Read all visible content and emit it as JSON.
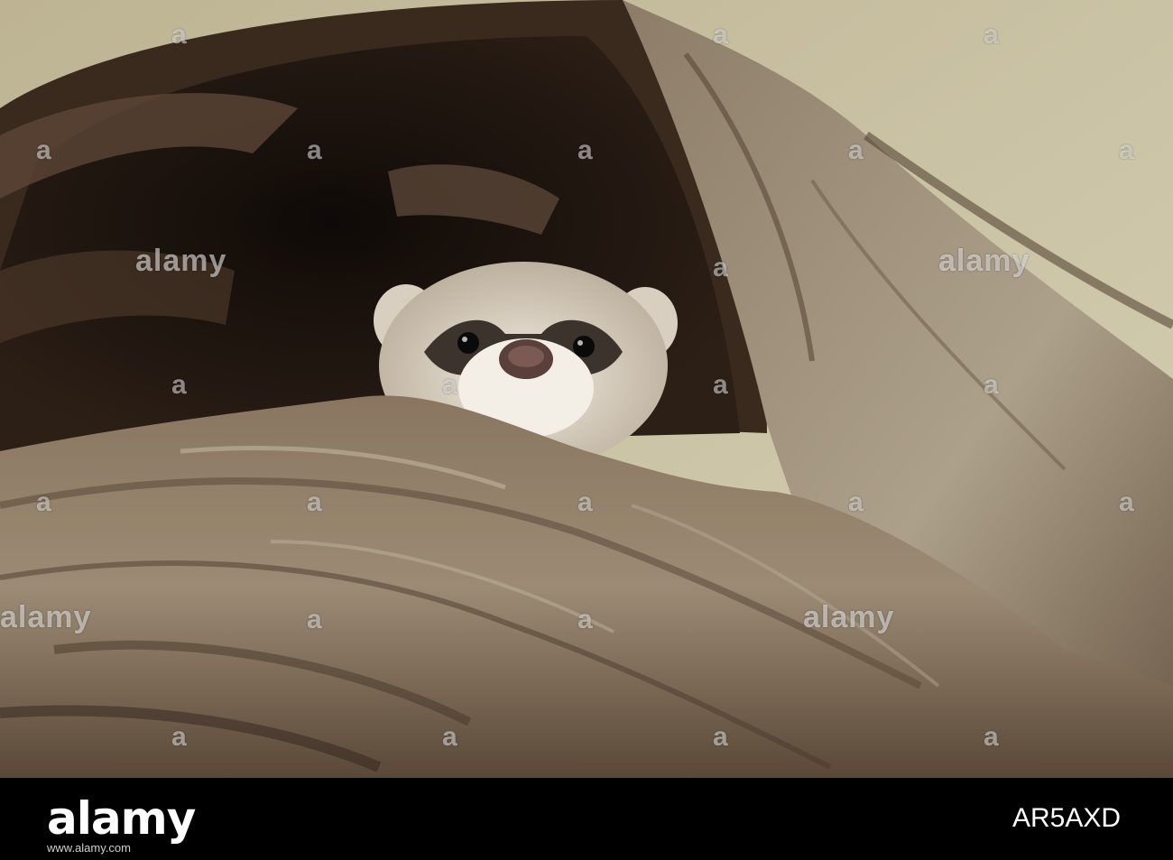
{
  "photo": {
    "subject": "ferret-peeking-from-hollow-log",
    "colors": {
      "bark_light": "#a89880",
      "bark_mid": "#6f5c48",
      "bark_dark": "#2c1f16",
      "hollow": "#1c130e",
      "background": "#cfc8a8",
      "fur_light": "#e8e0d2",
      "mask": "#3c332d"
    }
  },
  "watermark": {
    "text": "alamy",
    "short": "a"
  },
  "footer": {
    "logo": "alamy",
    "image_id": "AR5AXD",
    "url": "www.alamy.com"
  }
}
